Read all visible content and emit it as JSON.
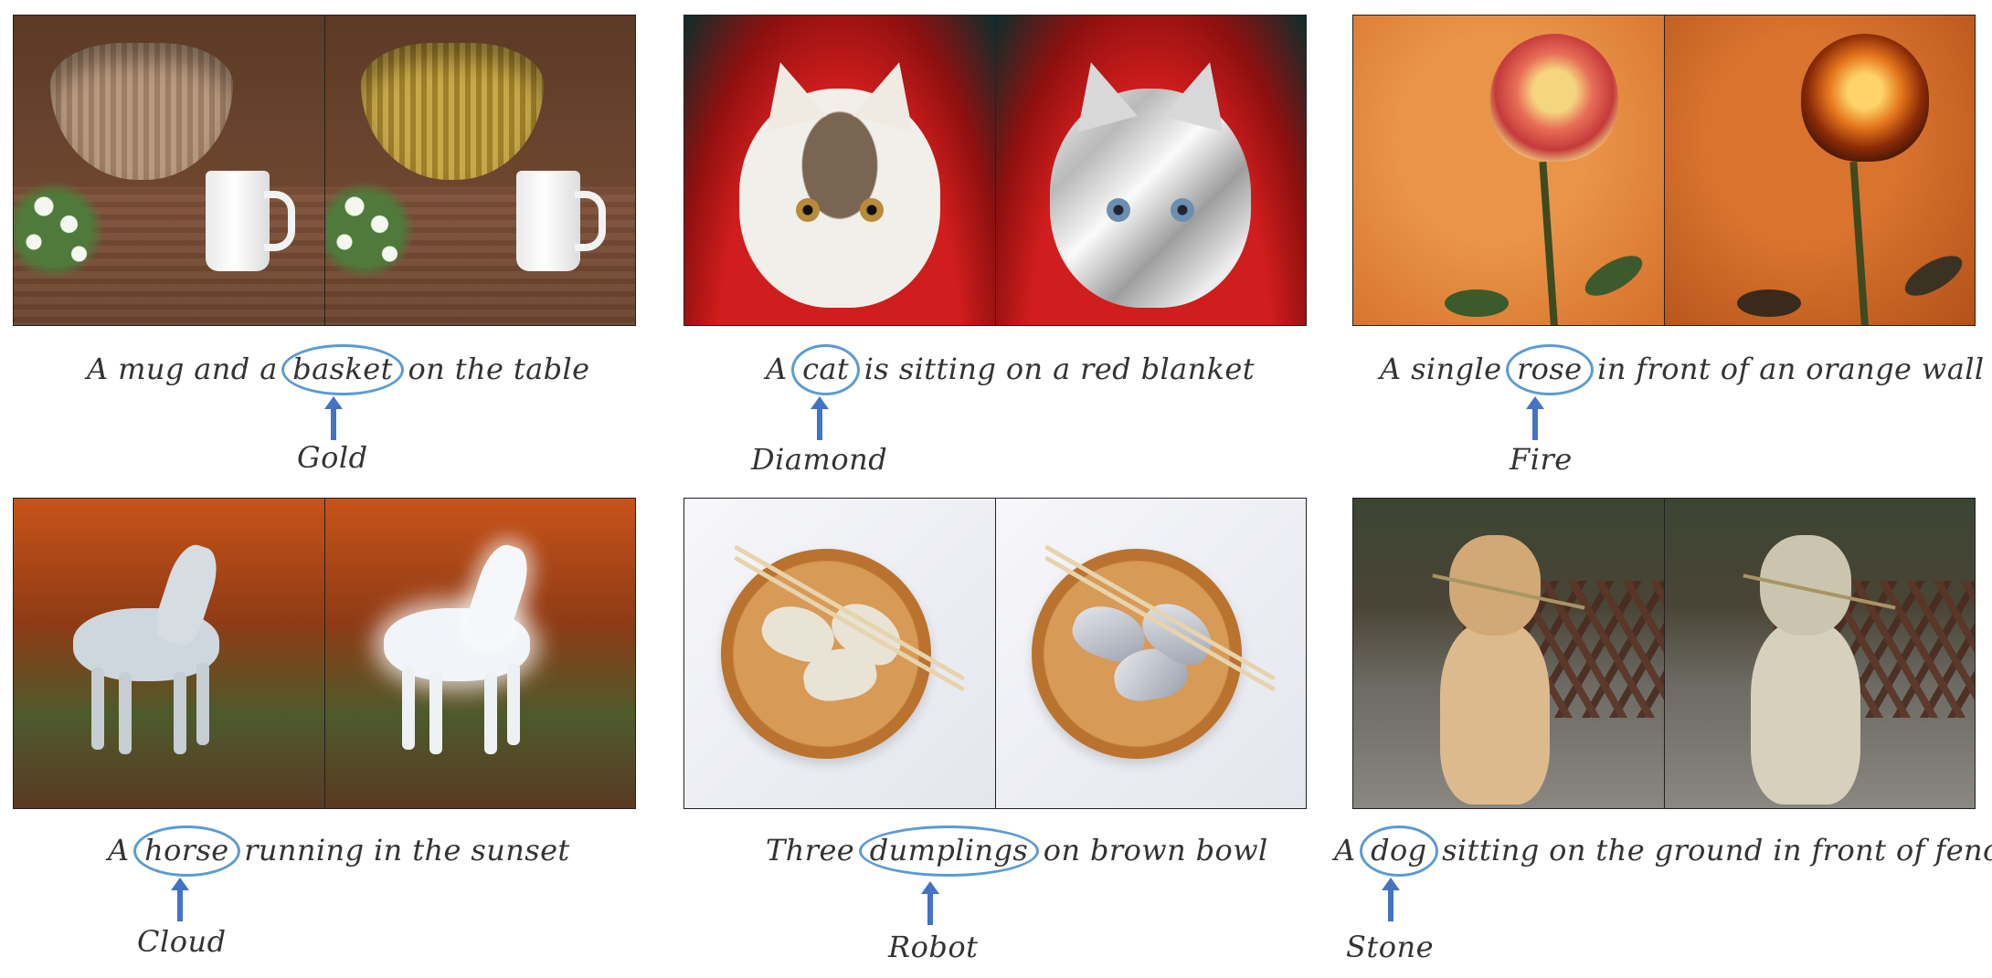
{
  "figure": {
    "rows": [
      [
        {
          "id": "p1",
          "caption_before": "A mug and a ",
          "keyword": "basket",
          "caption_after": " on the table",
          "material": "Gold"
        },
        {
          "id": "p2",
          "caption_before": "A ",
          "keyword": "cat",
          "caption_after": " is sitting on a red blanket",
          "material": "Diamond"
        },
        {
          "id": "p3",
          "caption_before": "A single ",
          "keyword": "rose",
          "caption_after": " in front of an orange wall",
          "material": "Fire"
        }
      ],
      [
        {
          "id": "p4",
          "caption_before": "A ",
          "keyword": "horse",
          "caption_after": " running in the sunset",
          "material": "Cloud"
        },
        {
          "id": "p5",
          "caption_before": "Three ",
          "keyword": "dumplings",
          "caption_after": " on brown bowl",
          "material": "Robot"
        },
        {
          "id": "p6",
          "caption_before": "A ",
          "keyword": "dog",
          "caption_after": " sitting on the ground in front of fence",
          "material": "Stone"
        }
      ]
    ],
    "colors": {
      "highlight": "#5b9bd5",
      "arrow": "#4472c4",
      "text": "#333333"
    }
  }
}
